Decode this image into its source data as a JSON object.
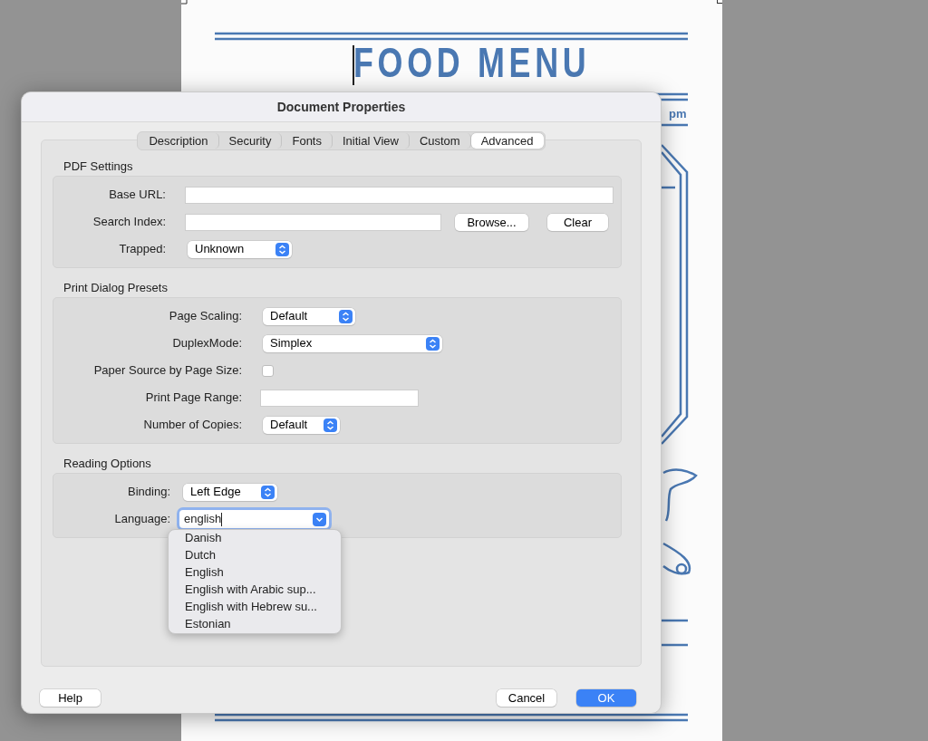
{
  "document": {
    "title": "FOOD MENU",
    "fragment": "pm"
  },
  "dialog": {
    "title": "Document Properties",
    "tabs": [
      {
        "label": "Description",
        "selected": false
      },
      {
        "label": "Security",
        "selected": false
      },
      {
        "label": "Fonts",
        "selected": false
      },
      {
        "label": "Initial View",
        "selected": false
      },
      {
        "label": "Custom",
        "selected": false
      },
      {
        "label": "Advanced",
        "selected": true
      }
    ],
    "sections": [
      {
        "title": "PDF Settings",
        "fields": [
          {
            "kind": "text",
            "label": "Base URL:"
          },
          {
            "kind": "text",
            "label": "Search Index:",
            "buttons": [
              "Browse...",
              "Clear"
            ]
          },
          {
            "kind": "select",
            "label": "Trapped:",
            "value": "Unknown"
          }
        ]
      },
      {
        "title": "Print Dialog Presets",
        "fields": [
          {
            "kind": "select",
            "label": "Page Scaling:",
            "value": "Default"
          },
          {
            "kind": "select",
            "label": "DuplexMode:",
            "value": "Simplex"
          },
          {
            "kind": "checkbox",
            "label": "Paper Source by Page Size:",
            "checked": false
          },
          {
            "kind": "text",
            "label": "Print Page Range:"
          },
          {
            "kind": "select",
            "label": "Number of Copies:",
            "value": "Default"
          }
        ]
      },
      {
        "title": "Reading Options",
        "fields": [
          {
            "kind": "select",
            "label": "Binding:",
            "value": "Left Edge"
          },
          {
            "kind": "combo",
            "label": "Language:",
            "value": "english",
            "focused": true
          }
        ]
      }
    ],
    "menu": [
      "Danish",
      "Dutch",
      "English",
      "English with Arabic sup...",
      "English with Hebrew su...",
      "Estonian"
    ],
    "buttons": [
      {
        "label": "Help",
        "kind": "plain"
      },
      {
        "label": "Cancel",
        "kind": "plain"
      },
      {
        "label": "OK",
        "kind": "default"
      }
    ]
  }
}
